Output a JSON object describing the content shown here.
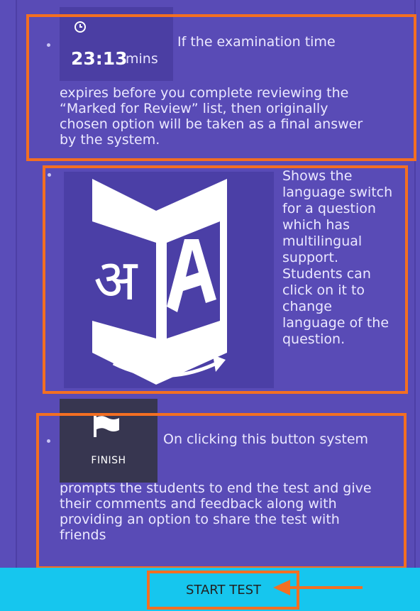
{
  "items": [
    {
      "timer": {
        "value": "23:13",
        "unit": "mins",
        "icon": "clock-icon"
      },
      "text_first": "If the examination time",
      "text_lines": [
        "expires before you complete reviewing the",
        "“Marked for Review” list, then originally",
        "chosen option will be taken as a final answer",
        "by the system."
      ]
    },
    {
      "icon": "language-switch-icon",
      "text_lines": [
        "Shows the",
        "language switch",
        "for a question",
        "which has",
        "multilingual",
        "support.",
        "Students can",
        "click on it to",
        "change",
        "language of the",
        "question."
      ]
    },
    {
      "finish": {
        "label": "FINISH",
        "icon": "flag-icon"
      },
      "text_first": "On clicking this button system",
      "text_lines": [
        "prompts the students to end the test and give",
        "their comments and feedback along with",
        "providing an option to share the test with",
        "friends"
      ]
    }
  ],
  "start_button": {
    "label": "START TEST"
  },
  "colors": {
    "panel": "#5a4db9",
    "highlight": "#f36f22",
    "bottom_bar": "#16c6ee",
    "finish_bg": "#373650"
  }
}
